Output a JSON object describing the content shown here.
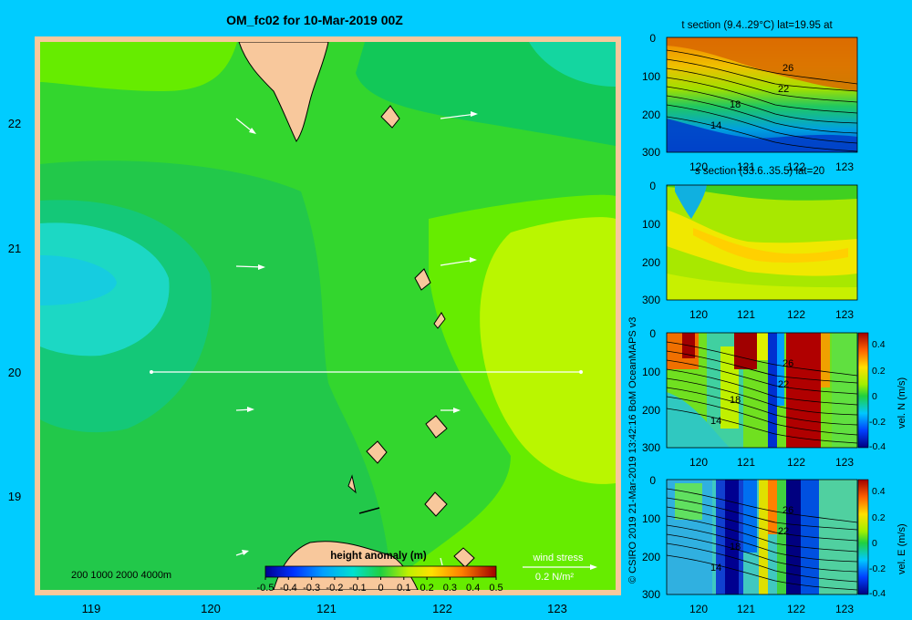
{
  "title": "OM_fc02 for 10-Mar-2019 00Z",
  "credit": "© CSIRO 2019   21-Mar-2019 13:42:16 BoM OceanMAPS v3",
  "colors": {
    "background": "#00ccff",
    "land": "#f8c89c",
    "frame": "#f8c89c",
    "arrows": "#ffffff"
  },
  "map": {
    "x_ticks": [
      "119",
      "120",
      "121",
      "122",
      "123"
    ],
    "y_ticks": [
      "22",
      "21",
      "20",
      "19"
    ],
    "xlim": [
      118.5,
      123.5
    ],
    "ylim": [
      18.3,
      22.7
    ],
    "depth_legend": "200  1000  2000  4000m",
    "colorbar_label": "height anomaly  (m)",
    "colorbar_ticks": [
      "-0.5",
      "-0.4",
      "-0.3",
      "-0.2",
      "-0.1",
      "0",
      "0.1",
      "0.2",
      "0.3",
      "0.4",
      "0.5"
    ],
    "colorbar_range": [
      -0.5,
      0.5
    ],
    "wind_label": "wind stress",
    "wind_scale": "0.2 N/m²",
    "transect_lat": 20
  },
  "chart_data": [
    {
      "type": "heatmap",
      "title": "OM_fc02 for 10-Mar-2019 00Z",
      "colorbar_label": "height anomaly  (m)",
      "x_ticks": [
        119,
        120,
        121,
        122,
        123
      ],
      "y_ticks": [
        19,
        20,
        21,
        22
      ],
      "xlim": [
        118.5,
        123.5
      ],
      "ylim": [
        18.3,
        22.7
      ],
      "color_range": [
        -0.5,
        0.5
      ],
      "wind_stress_vectors": [
        {
          "lon": 120.2,
          "lat": 22.0,
          "u": 0.1,
          "v": -0.05
        },
        {
          "lon": 121.9,
          "lat": 22.05,
          "u": 0.15,
          "v": 0.02
        },
        {
          "lon": 120.2,
          "lat": 20.85,
          "u": 0.12,
          "v": 0.0
        },
        {
          "lon": 121.9,
          "lat": 20.85,
          "u": 0.14,
          "v": 0.03
        },
        {
          "lon": 120.2,
          "lat": 19.7,
          "u": 0.07,
          "v": 0.0
        },
        {
          "lon": 121.9,
          "lat": 19.7,
          "u": 0.07,
          "v": 0.0
        },
        {
          "lon": 120.2,
          "lat": 18.55,
          "u": 0.05,
          "v": 0.02
        }
      ]
    },
    {
      "type": "heatmap",
      "title": "t section (9.4..29°C) lat=19.95 at",
      "x_ticks": [
        "120",
        "121",
        "122",
        "123"
      ],
      "y_ticks": [
        "0",
        "100",
        "200",
        "300"
      ],
      "xlim": [
        119.5,
        123.2
      ],
      "ylim": [
        300,
        0
      ],
      "contour_labels": [
        "26",
        "22",
        "18",
        "14"
      ]
    },
    {
      "type": "heatmap",
      "title": "s section (33.6..35.5) lat=20",
      "x_ticks": [
        "120",
        "121",
        "122",
        "123"
      ],
      "y_ticks": [
        "0",
        "100",
        "200",
        "300"
      ],
      "xlim": [
        119.5,
        123.2
      ],
      "ylim": [
        300,
        0
      ]
    },
    {
      "type": "heatmap",
      "ylabel": "vel. N  (m/s)",
      "x_ticks": [
        "120",
        "121",
        "122",
        "123"
      ],
      "y_ticks": [
        "0",
        "100",
        "200",
        "300"
      ],
      "cbar_ticks": [
        "0.4",
        "0.2",
        "0",
        "-0.2",
        "-0.4"
      ],
      "xlim": [
        119.5,
        123.2
      ],
      "ylim": [
        300,
        0
      ],
      "color_range": [
        -0.4,
        0.4
      ],
      "contour_labels": [
        "26",
        "22",
        "18",
        "14"
      ]
    },
    {
      "type": "heatmap",
      "ylabel": "vel. E  (m/s)",
      "x_ticks": [
        "120",
        "121",
        "122",
        "123"
      ],
      "y_ticks": [
        "0",
        "100",
        "200",
        "300"
      ],
      "cbar_ticks": [
        "0.4",
        "0.2",
        "0",
        "-0.2",
        "-0.4"
      ],
      "xlim": [
        119.5,
        123.2
      ],
      "ylim": [
        300,
        0
      ],
      "color_range": [
        -0.4,
        0.4
      ],
      "contour_labels": [
        "26",
        "22",
        "18",
        "14"
      ]
    }
  ],
  "panels": [
    {
      "title": "t section (9.4..29°C) lat=19.95 at",
      "x_ticks": [
        "120",
        "121",
        "122",
        "123"
      ],
      "y_ticks": [
        "0",
        "100",
        "200",
        "300"
      ],
      "contour_labels": [
        "26",
        "22",
        "18",
        "14"
      ],
      "cbar": null
    },
    {
      "title": "s section (33.6..35.5) lat=20",
      "x_ticks": [
        "120",
        "121",
        "122",
        "123"
      ],
      "y_ticks": [
        "0",
        "100",
        "200",
        "300"
      ],
      "contour_labels": [],
      "cbar": null
    },
    {
      "title": "",
      "x_ticks": [
        "120",
        "121",
        "122",
        "123"
      ],
      "y_ticks": [
        "0",
        "100",
        "200",
        "300"
      ],
      "contour_labels": [
        "26",
        "22",
        "18",
        "14"
      ],
      "cbar": {
        "label": "vel. N  (m/s)",
        "ticks": [
          "0.4",
          "0.2",
          "0",
          "-0.2",
          "-0.4"
        ]
      }
    },
    {
      "title": "",
      "x_ticks": [
        "120",
        "121",
        "122",
        "123"
      ],
      "y_ticks": [
        "0",
        "100",
        "200",
        "300"
      ],
      "contour_labels": [
        "26",
        "22",
        "18",
        "14"
      ],
      "cbar": {
        "label": "vel. E  (m/s)",
        "ticks": [
          "0.4",
          "0.2",
          "0",
          "-0.2",
          "-0.4"
        ]
      }
    }
  ]
}
